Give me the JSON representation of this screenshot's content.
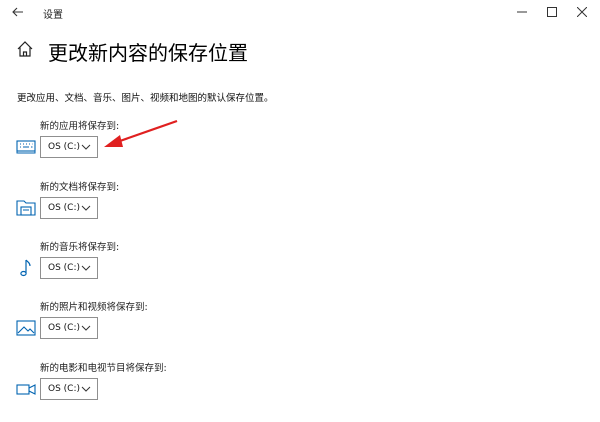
{
  "window": {
    "back_icon": "arrow-left-icon",
    "title": "设置",
    "controls": [
      "minimize-icon",
      "maximize-icon",
      "close-icon"
    ]
  },
  "page": {
    "title": "更改新内容的保存位置",
    "description": "更改应用、文档、音乐、图片、视频和地图的默认保存位置。"
  },
  "sections": [
    {
      "label": "新的应用将保存到:",
      "icon": "monitor-keyboard-icon",
      "value": "OS (C:)"
    },
    {
      "label": "新的文档将保存到:",
      "icon": "document-drive-icon",
      "value": "OS (C:)"
    },
    {
      "label": "新的音乐将保存到:",
      "icon": "music-note-icon",
      "value": "OS (C:)"
    },
    {
      "label": "新的照片和视频将保存到:",
      "icon": "picture-icon",
      "value": "OS (C:)"
    },
    {
      "label": "新的电影和电视节目将保存到:",
      "icon": "video-camera-icon",
      "value": "OS (C:)"
    }
  ],
  "colors": {
    "accent": "#0063b1",
    "annotation": "#e02020"
  }
}
